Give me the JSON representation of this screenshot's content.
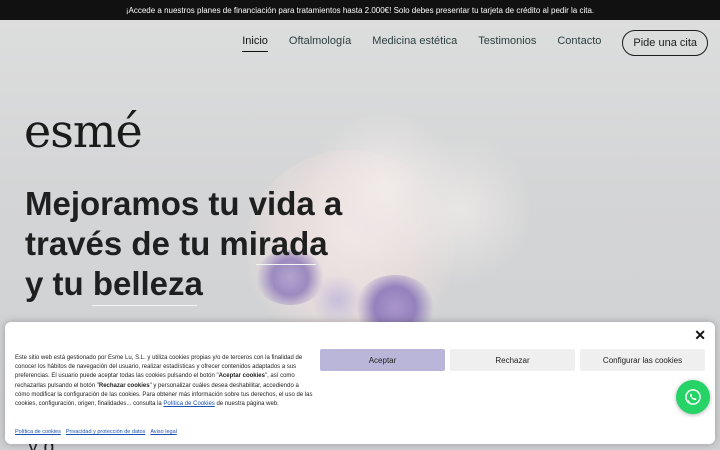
{
  "topbar": {
    "text": "¡Accede a nuestros planes de financiación para tratamientos hasta 2.000€! Solo debes presentar tu tarjeta de crédito al pedir la cita."
  },
  "nav": {
    "items": [
      {
        "label": "Inicio",
        "active": true
      },
      {
        "label": "Oftalmología",
        "active": false
      },
      {
        "label": "Medicina estética",
        "active": false
      },
      {
        "label": "Testimonios",
        "active": false
      },
      {
        "label": "Contacto",
        "active": false
      }
    ],
    "cta": "Pide una cita"
  },
  "hero": {
    "logo": "esmé",
    "tagline": [
      "Mejoramos tu vida a",
      "través de tu mirada",
      "y tu belleza"
    ]
  },
  "cookie": {
    "close": "✕",
    "text_1": "Este sitio web está gestionado por Esme Lu, S.L. y utiliza cookies propias y/o de terceros con la finalidad de conocer los hábitos de navegación del usuario, realizar estadísticas y ofrecer contenidos adaptados a sus preferencias. El usuario puede aceptar todas las cookies pulsando el botón \"",
    "bold_1": "Aceptar cookies",
    "text_2": "\", así como rechazarlas pulsando el botón \"",
    "bold_2": "Rechazar cookies",
    "text_3": "\" y personalizar cuáles desea deshabilitar, accediendo a cómo modificar la configuración de las cookies. Para obtener más información sobre tus derechos, el uso de las cookies, configuración, origen, finalidades... consulta la ",
    "policy_link": "Política de Cookies",
    "text_4": " de nuestra página web.",
    "buttons": {
      "accept": "Aceptar",
      "reject": "Rechazar",
      "config": "Configurar las cookies"
    },
    "footer_links": [
      "Política de cookies",
      "Privacidad y protección de datos",
      "Aviso legal"
    ]
  },
  "icons": {
    "whatsapp": "whatsapp-icon",
    "close": "close-icon"
  },
  "colors": {
    "accept_button": "#b9b6da",
    "whatsapp": "#25d366",
    "topbar": "#111111"
  }
}
